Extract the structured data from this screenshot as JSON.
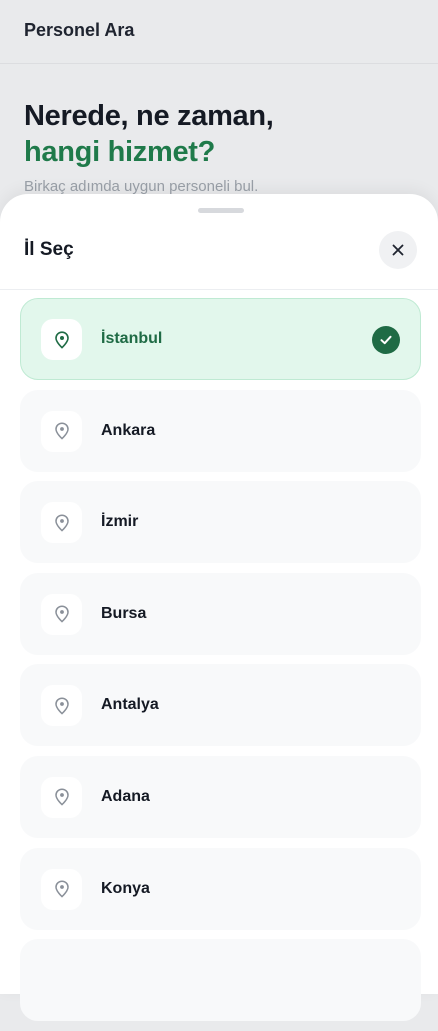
{
  "topbar": {
    "title": "Personel Ara"
  },
  "hero": {
    "line1": "Nerede, ne zaman,",
    "line2": "hangi hizmet?",
    "subtitle": "Birkaç adımda uygun personeli bul."
  },
  "sheet": {
    "title": "İl Seç",
    "selected": "İstanbul",
    "cities": [
      "İstanbul",
      "Ankara",
      "İzmir",
      "Bursa",
      "Antalya",
      "Adana",
      "Konya",
      ""
    ]
  },
  "colors": {
    "accent": "#1f7a4a",
    "selected_bg": "#e2f7ec",
    "selected_border": "#bfead3",
    "check_bg": "#1f6b45"
  },
  "icons": {
    "close": "close-icon",
    "pin": "map-pin-icon",
    "check": "check-icon"
  }
}
